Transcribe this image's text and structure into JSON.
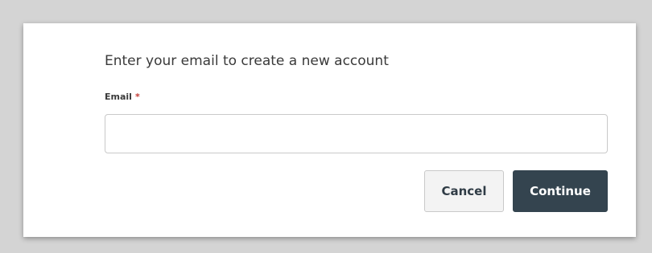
{
  "dialog": {
    "heading": "Enter your email to create a new account",
    "email_label": "Email",
    "required_marker": "*",
    "email_value": "",
    "cancel_label": "Cancel",
    "continue_label": "Continue"
  },
  "colors": {
    "backdrop": "#d4d4d4",
    "primary_button": "#34444f",
    "required": "#c23934"
  }
}
